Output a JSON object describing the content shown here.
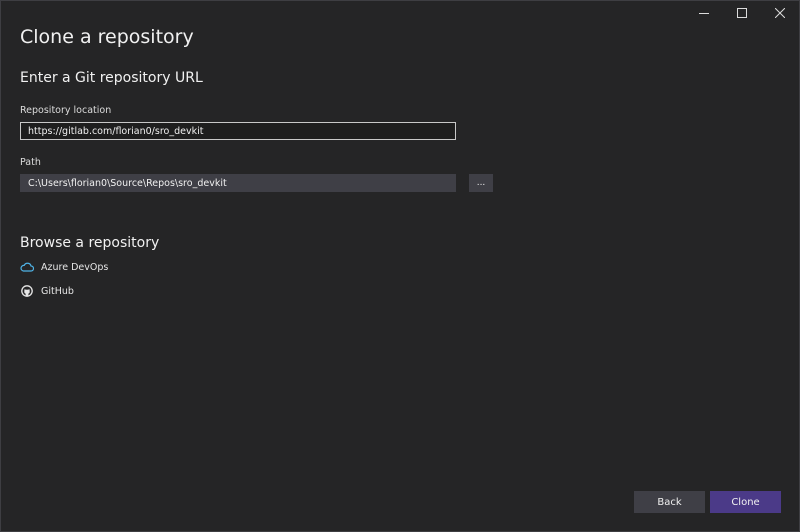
{
  "window": {
    "heading": "Clone a repository"
  },
  "url_section": {
    "title": "Enter a Git repository URL",
    "repo_location_label": "Repository location",
    "repo_location_value": "https://gitlab.com/florian0/sro_devkit",
    "path_label": "Path",
    "path_value": "C:\\Users\\florian0\\Source\\Repos\\sro_devkit",
    "browse_label": "..."
  },
  "browse_section": {
    "title": "Browse a repository",
    "providers": [
      {
        "label": "Azure DevOps",
        "icon": "cloud-icon"
      },
      {
        "label": "GitHub",
        "icon": "github-icon"
      }
    ]
  },
  "footer": {
    "back_label": "Back",
    "clone_label": "Clone"
  },
  "colors": {
    "background": "#252526",
    "accent": "#4b3a88",
    "input_bg": "#3f3f46"
  }
}
